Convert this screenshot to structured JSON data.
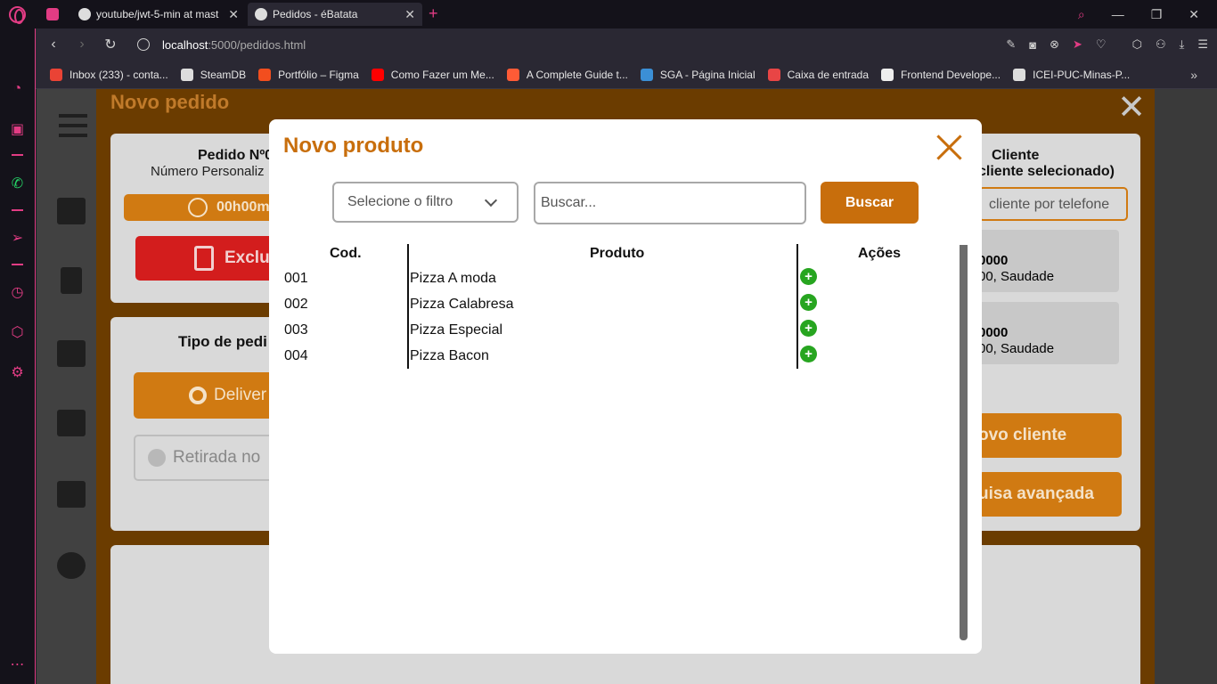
{
  "browser": {
    "tabs": [
      {
        "title": "",
        "icon": "gamepad-icon"
      },
      {
        "title": "youtube/jwt-5-min at mast",
        "icon": "github-icon"
      },
      {
        "title": "Pedidos - éBatata",
        "icon": "globe-icon"
      }
    ],
    "url_host": "localhost",
    "url_path": ":5000/pedidos.html",
    "bookmarks": [
      {
        "label": "Inbox (233) - conta...",
        "color": "#ea4335"
      },
      {
        "label": "SteamDB",
        "color": "#dddddd"
      },
      {
        "label": "Portfólio – Figma",
        "color": "#f24e1e"
      },
      {
        "label": "Como Fazer um Me...",
        "color": "#ff0000"
      },
      {
        "label": "A Complete Guide t...",
        "color": "#ff5b36"
      },
      {
        "label": "SGA - Página Inicial",
        "color": "#3b8fd6"
      },
      {
        "label": "Caixa de entrada",
        "color": "#e84545"
      },
      {
        "label": "Frontend Develope...",
        "color": "#eeeeee"
      },
      {
        "label": "ICEI-PUC-Minas-P...",
        "color": "#dddddd"
      }
    ]
  },
  "pedido": {
    "title": "Novo pedido",
    "pedido_label": "Pedido Nº0",
    "numero_label": "Número Personaliz",
    "timer": "00h00m",
    "excluir": "Exclu",
    "tipo_label": "Tipo de pedi",
    "delivery": "Deliver",
    "retirada": "Retirada no",
    "cliente_title": "Cliente",
    "cliente_sub": "cliente selecionado)",
    "cliente_search": "cliente por telefone",
    "cliente_cards": [
      {
        "num": "0000",
        "addr": "00, Saudade"
      },
      {
        "num": "0000",
        "addr": "00, Saudade"
      }
    ],
    "novo_cliente": "ovo cliente",
    "pesquisa": "uisa avançada"
  },
  "modal": {
    "title": "Novo produto",
    "filter_placeholder": "Selecione o filtro",
    "search_placeholder": "Buscar...",
    "search_button": "Buscar",
    "columns": {
      "cod": "Cod.",
      "produto": "Produto",
      "acoes": "Ações"
    },
    "rows": [
      {
        "cod": "001",
        "produto": "Pizza A moda"
      },
      {
        "cod": "002",
        "produto": "Pizza Calabresa"
      },
      {
        "cod": "003",
        "produto": "Pizza Especial"
      },
      {
        "cod": "004",
        "produto": "Pizza Bacon"
      }
    ],
    "add_symbol": "+",
    "accent_color": "#c86e0c",
    "add_color": "#27a520"
  }
}
